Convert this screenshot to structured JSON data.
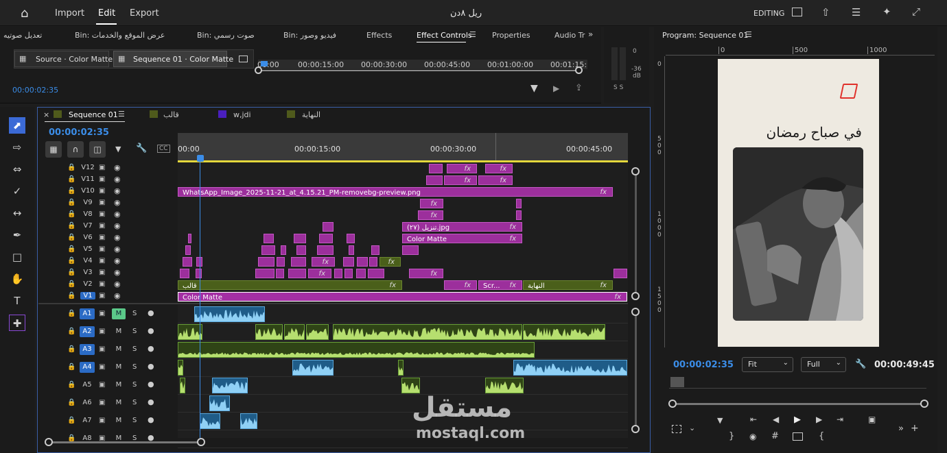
{
  "menu": {
    "import": "Import",
    "edit": "Edit",
    "export": "Export",
    "project_title": "ريل ٨دن",
    "workspace": "EDITING"
  },
  "panel_tabs": [
    "تعديل صوتيه",
    "Bin: عرض الموقع والخدمات",
    "Bin: صوت رسمي",
    "Bin: فيديو وصور",
    "Effects",
    "Effect Controls",
    "Properties",
    "Audio Tr"
  ],
  "source": {
    "tab_source": "Source · Color Matte",
    "tab_sequence": "Sequence 01 · Color Matte",
    "timecodes": [
      "00:00",
      "00:00:15:00",
      "00:00:30:00",
      "00:00:45:00",
      "00:01:00:00",
      "00:01:15:"
    ],
    "current_time": "00:00:02:35"
  },
  "meter": {
    "top": "0",
    "mid": "-36",
    "unit": "dB",
    "solo": "S S"
  },
  "timeline": {
    "sequence_name": "Sequence 01",
    "other_tabs": [
      "قالب",
      "w,jdi",
      "النهاية"
    ],
    "tab_colors": [
      "#4f5a1c",
      "#4f5a1c",
      "#4a1fbe",
      "#4f5a1c"
    ],
    "timecode": "00:00:02:35",
    "ruler": [
      "00:00",
      "00:00:15:00",
      "00:00:30:00",
      "00:00:45:00"
    ],
    "video_tracks": [
      "V12",
      "V11",
      "V10",
      "V9",
      "V8",
      "V7",
      "V6",
      "V5",
      "V4",
      "V3",
      "V2",
      "V1"
    ],
    "audio_tracks": [
      "A1",
      "A2",
      "A3",
      "A4",
      "A5",
      "A6",
      "A7",
      "A8"
    ],
    "clip_v10": "WhatsApp_Image_2025-11-21_at_4.15.21_PM-removebg-preview.png",
    "clip_v7": "(٢٧) تنزيل.jpg",
    "clip_v6": "Color Matte",
    "clip_v2a": "قالب",
    "clip_v2b": "Scr...",
    "clip_v2c": "النهاية",
    "clip_v1": "Color Matte",
    "fx": "fx",
    "mute": "M",
    "solo": "S"
  },
  "program": {
    "title": "Program: Sequence 01",
    "ruler": [
      "0",
      "500",
      "1000"
    ],
    "vruler": [
      "0",
      "500",
      "1000",
      "1500"
    ],
    "overlay_text": "في صباح رمضان",
    "timecode": "00:00:02:35",
    "fit": "Fit",
    "quality": "Full",
    "duration": "00:00:49:45"
  },
  "watermark": {
    "ar": "مستقل",
    "en": "mostaql.com"
  },
  "colors": {
    "accent": "#3b8de8",
    "clip_purple": "#9c2f9c",
    "clip_green": "#4a5f1a",
    "audio_blue": "#1f5c88",
    "track_active": "#2b6bc5"
  }
}
